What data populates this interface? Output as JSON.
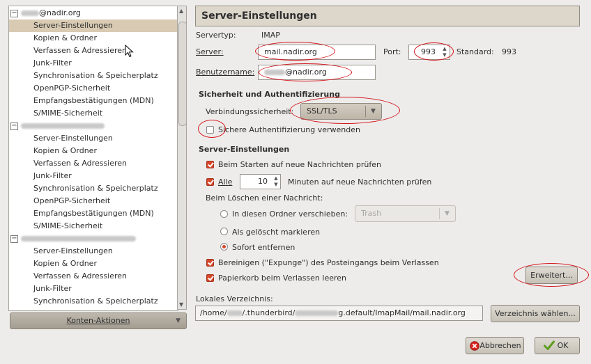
{
  "tree": {
    "accounts": [
      {
        "name_visible": "@nadir.org",
        "items": [
          "Server-Einstellungen",
          "Kopien & Ordner",
          "Verfassen & Adressieren",
          "Junk-Filter",
          "Synchronisation & Speicherplatz",
          "OpenPGP-Sicherheit",
          "Empfangsbestätigungen (MDN)",
          "S/MIME-Sicherheit"
        ]
      },
      {
        "name_visible": "",
        "items": [
          "Server-Einstellungen",
          "Kopien & Ordner",
          "Verfassen & Adressieren",
          "Junk-Filter",
          "Synchronisation & Speicherplatz",
          "OpenPGP-Sicherheit",
          "Empfangsbestätigungen (MDN)",
          "S/MIME-Sicherheit"
        ]
      },
      {
        "name_visible": "",
        "items": [
          "Server-Einstellungen",
          "Kopien & Ordner",
          "Verfassen & Adressieren",
          "Junk-Filter",
          "Synchronisation & Speicherplatz"
        ]
      }
    ],
    "expander_glyph": "−"
  },
  "konten_aktionen": "Konten-Aktionen",
  "panel": {
    "title": "Server-Einstellungen",
    "servertyp_label": "Servertyp:",
    "servertyp_value": "IMAP",
    "server_label": "Server:",
    "server_value": "mail.nadir.org",
    "port_label": "Port:",
    "port_value": "993",
    "standard_label": "Standard:",
    "standard_value": "993",
    "benutzer_label": "Benutzername:",
    "benutzer_value": "@nadir.org"
  },
  "security": {
    "heading": "Sicherheit und Authentifizierung",
    "verbindung_label": "Verbindungssicherheit:",
    "verbindung_value": "SSL/TLS",
    "sichere_auth_label": "Sichere Authentifizierung verwenden",
    "sichere_auth_checked": false
  },
  "server_settings": {
    "heading": "Server-Einstellungen",
    "start_check_label": "Beim Starten auf neue Nachrichten prüfen",
    "start_check_checked": true,
    "alle_label": "Alle",
    "alle_checked": true,
    "minutes_value": "10",
    "minutes_label": "Minuten auf neue Nachrichten prüfen",
    "delete_heading": "Beim Löschen einer Nachricht:",
    "radio_move_label": "In diesen Ordner verschieben:",
    "trash_value": "Trash",
    "radio_mark_label": "Als gelöscht markieren",
    "radio_remove_label": "Sofort entfernen",
    "selected_radio": "Sofort entfernen",
    "expunge_label": "Bereinigen (\"Expunge\") des Posteingangs beim Verlassen",
    "expunge_checked": true,
    "trash_empty_label": "Papierkorb beim Verlassen leeren",
    "trash_empty_checked": true,
    "erweitert_label": "Erweitert..."
  },
  "local": {
    "label": "Lokales Verzeichnis:",
    "path_start": "/home/",
    "path_mid": "/.thunderbird/",
    "path_end": "g.default/ImapMail/mail.nadir.org",
    "choose_label": "Verzeichnis wählen..."
  },
  "footer": {
    "cancel_label": "Abbrechen",
    "ok_label": "OK"
  },
  "colors": {
    "selection": "#d9cbb3",
    "check_accent": "#d8472a",
    "annotation_red": "#d4151a"
  },
  "icons": [
    "cancel-icon",
    "ok-check-icon",
    "mouse-pointer-icon",
    "dropdown-arrow-icon",
    "spin-arrows-icon"
  ]
}
